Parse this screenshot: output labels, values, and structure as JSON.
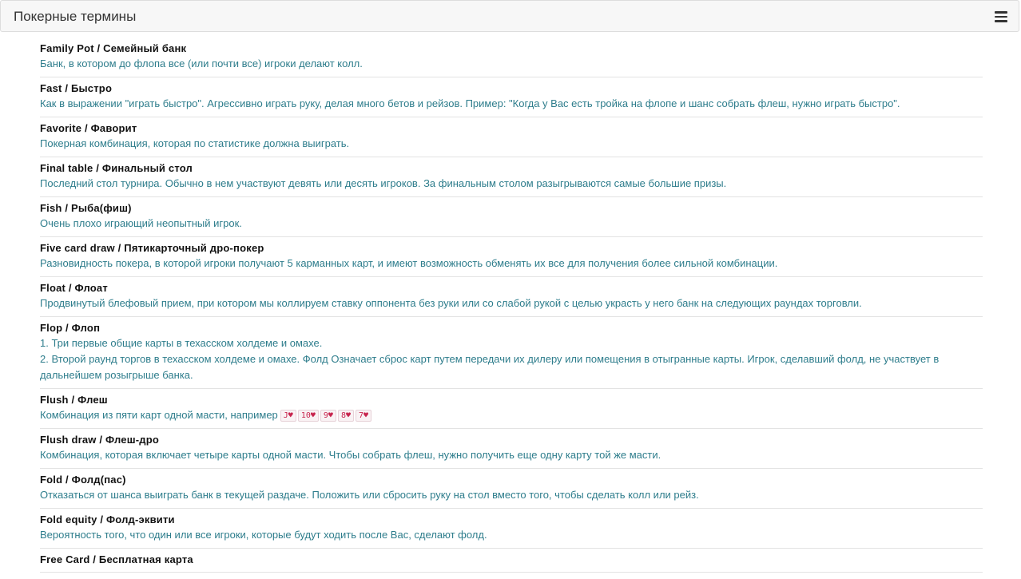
{
  "header": {
    "title": "Покерные термины",
    "menu_icon": "hamburger-menu-icon"
  },
  "colors": {
    "term_title": "#111111",
    "term_desc": "#2e7d8c",
    "card_text": "#c7254e",
    "header_bg": "#f7f7f7"
  },
  "terms": [
    {
      "title": "Family Pot / Семейный банк",
      "desc": [
        "Банк, в котором до флопа все (или почти все) игроки делают колл."
      ]
    },
    {
      "title": "Fast / Быстро",
      "desc": [
        "Как в выражении \"играть быстро\". Агрессивно играть руку, делая много бетов и рейзов. Пример: \"Когда у Вас есть тройка на флопе и шанс собрать флеш, нужно играть быстро\"."
      ]
    },
    {
      "title": "Favorite / Фаворит",
      "desc": [
        "Покерная комбинация, которая по статистике должна выиграть."
      ]
    },
    {
      "title": "Final table / Финальный стол",
      "desc": [
        "Последний стол турнира. Обычно в нем участвуют девять или десять игроков. За финальным столом разыгрываются самые большие призы."
      ]
    },
    {
      "title": "Fish / Рыба(фиш)",
      "desc": [
        "Очень плохо играющий неопытный игрок."
      ]
    },
    {
      "title": "Five card draw / Пятикарточный дро-покер",
      "desc": [
        "Разновидность покера, в которой игроки получают 5 карманных карт, и имеют возможность обменять их все для получения более сильной комбинации."
      ]
    },
    {
      "title": "Float / Флоат",
      "desc": [
        "Продвинутый блефовый прием, при котором мы коллируем ставку оппонента без руки или со слабой рукой с целью украсть у него банк на следующих раундах торговли."
      ]
    },
    {
      "title": "Flop / Флоп",
      "desc": [
        "1. Три первые общие карты в техасском холдеме и омахе.",
        "2. Второй раунд торгов в техасском холдеме и омахе. Фолд Означает сброс карт путем передачи их дилеру или помещения в отыгранные карты. Игрок, сделавший фолд, не участвует в дальнейшем розыгрыше банка."
      ]
    },
    {
      "title": "Flush / Флеш",
      "desc": [
        "Комбинация из пяти карт одной масти, например"
      ],
      "cards": [
        "J♥",
        "10♥",
        "9♥",
        "8♥",
        "7♥"
      ]
    },
    {
      "title": "Flush draw / Флеш-дро",
      "desc": [
        "Комбинация, которая включает четыре карты одной масти. Чтобы собрать флеш, нужно получить еще одну карту той же масти."
      ]
    },
    {
      "title": "Fold / Фолд(пас)",
      "desc": [
        "Отказаться от шанса выиграть банк в текущей раздаче. Положить или сбросить руку на стол вместо того, чтобы сделать колл или рейз."
      ]
    },
    {
      "title": "Fold equity / Фолд-эквити",
      "desc": [
        "Вероятность того, что один или все игроки, которые будут ходить после Вас, сделают фолд."
      ]
    },
    {
      "title": "Free Card / Бесплатная карта",
      "desc": []
    }
  ]
}
